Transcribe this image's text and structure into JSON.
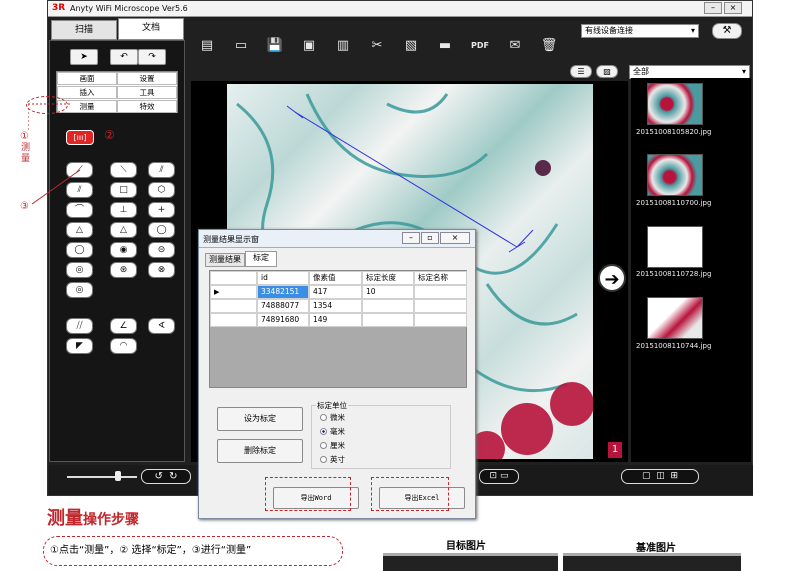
{
  "window": {
    "logo": "3R",
    "title": "Anyty WiFi Microscope Ver5.6",
    "tabs": [
      "扫描",
      "文档"
    ]
  },
  "left_panel": {
    "menu_items": [
      "画面",
      "设置",
      "插入",
      "工具",
      "测量",
      "特效"
    ],
    "ruler_button": "[ııı]",
    "annotation_2": "②",
    "tools": [
      "⟋",
      "⟍",
      "⫽",
      "⫽",
      "□",
      "⬡",
      "⌒",
      "⊥",
      "+",
      "△",
      "△",
      "◯",
      "◯",
      "◉",
      "⊝",
      "◎",
      "⊛",
      "⊗",
      "◎",
      "⧸⧸",
      "∠",
      "∢",
      "◤",
      "◠"
    ]
  },
  "toolbar": {
    "icons": [
      "document-icon",
      "folder-icon",
      "save-icon",
      "save-as-icon",
      "copy-icon",
      "scissors-icon",
      "paste-icon",
      "print-icon",
      "pdf-icon",
      "mail-icon",
      "trash-icon"
    ],
    "glyphs": [
      "▤",
      "▭",
      "💾",
      "▣",
      "▥",
      "✂",
      "▧",
      "▬",
      "PDF",
      "✉",
      "🗑"
    ],
    "device_select": "有线设备连接",
    "filter_select": "全部"
  },
  "thumbnails": [
    {
      "name": "20151008105820.jpg"
    },
    {
      "name": "20151008110700.jpg"
    },
    {
      "name": "20151008110728.jpg"
    },
    {
      "name": "20151008110744.jpg"
    }
  ],
  "dialog": {
    "title": "测量结果显示窗",
    "tabs": [
      "测量结果",
      "标定"
    ],
    "columns": [
      "id",
      "像素值",
      "标定长度",
      "标定名称"
    ],
    "rows": [
      {
        "id": "33482151",
        "pixel": "417",
        "length": "10",
        "name": ""
      },
      {
        "id": "74888077",
        "pixel": "1354",
        "length": "",
        "name": ""
      },
      {
        "id": "74891680",
        "pixel": "149",
        "length": "",
        "name": ""
      }
    ],
    "buttons": {
      "set": "设为标定",
      "delete": "删除标定",
      "export_word": "导出Word",
      "export_excel": "导出Excel"
    },
    "unit_group": {
      "label": "标定单位",
      "options": [
        "微米",
        "毫米",
        "厘米",
        "英寸"
      ],
      "selected": "毫米"
    }
  },
  "annotations": {
    "step1_circle": "①",
    "step1_text": "测量",
    "step3": "③",
    "heading_big": "测量",
    "heading_small": "操作步骤",
    "instructions": "①点击“测量”，② 选择“标定”，③进行“测量”",
    "target_label": "目标图片",
    "reference_label": "基准图片",
    "marker": "1"
  },
  "colors": {
    "red_annotation": "#c0262b",
    "app_dark": "#202020",
    "measure_line": "#3030e0"
  }
}
